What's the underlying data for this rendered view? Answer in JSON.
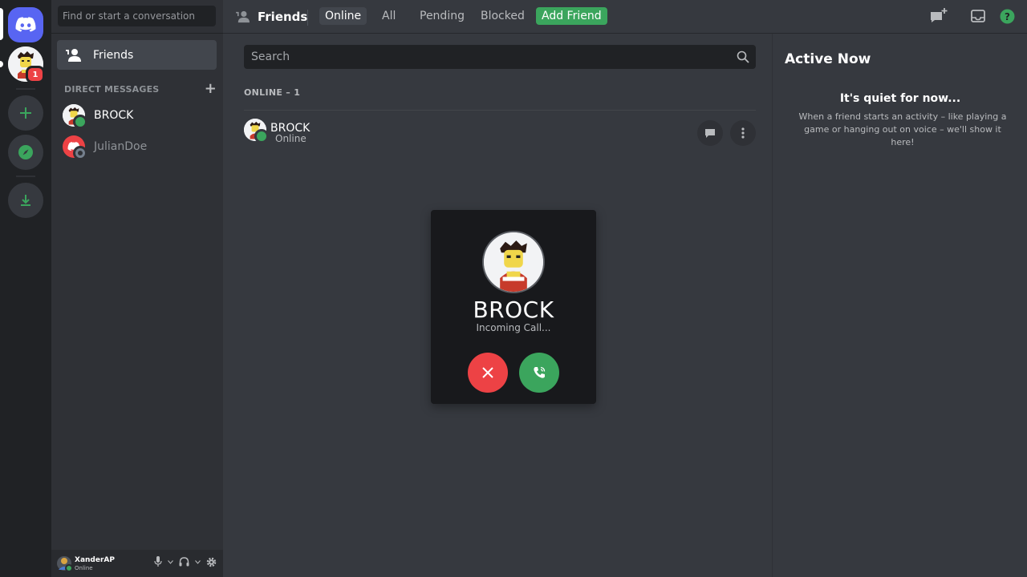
{
  "sidebar": {
    "search_placeholder": "Find or start a conversation",
    "friends_label": "Friends",
    "dm_header": "DIRECT MESSAGES",
    "dms": [
      {
        "name": "BROCK",
        "status": "online"
      },
      {
        "name": "JulianDoe",
        "status": "offline"
      }
    ]
  },
  "guilds": {
    "notification_count": "1"
  },
  "topbar": {
    "title": "Friends",
    "tabs": [
      "Online",
      "All",
      "Pending",
      "Blocked"
    ],
    "active_tab": "Online",
    "add_friend": "Add Friend"
  },
  "main": {
    "search_placeholder": "Search",
    "online_header": "ONLINE – 1",
    "friends": [
      {
        "name": "BROCK",
        "status": "Online"
      }
    ]
  },
  "active_now": {
    "title": "Active Now",
    "empty_title": "It's quiet for now...",
    "empty_desc": "When a friend starts an activity – like playing a game or hanging out on voice – we'll show it here!"
  },
  "call": {
    "caller": "BROCK",
    "status": "Incoming Call..."
  },
  "user": {
    "name": "XanderAP",
    "status": "Online"
  },
  "colors": {
    "brand": "#5865f2",
    "online": "#3ba55d",
    "danger": "#ed4245",
    "background": "#36393f",
    "sidebar": "#2f3136",
    "guild_bar": "#202225"
  }
}
